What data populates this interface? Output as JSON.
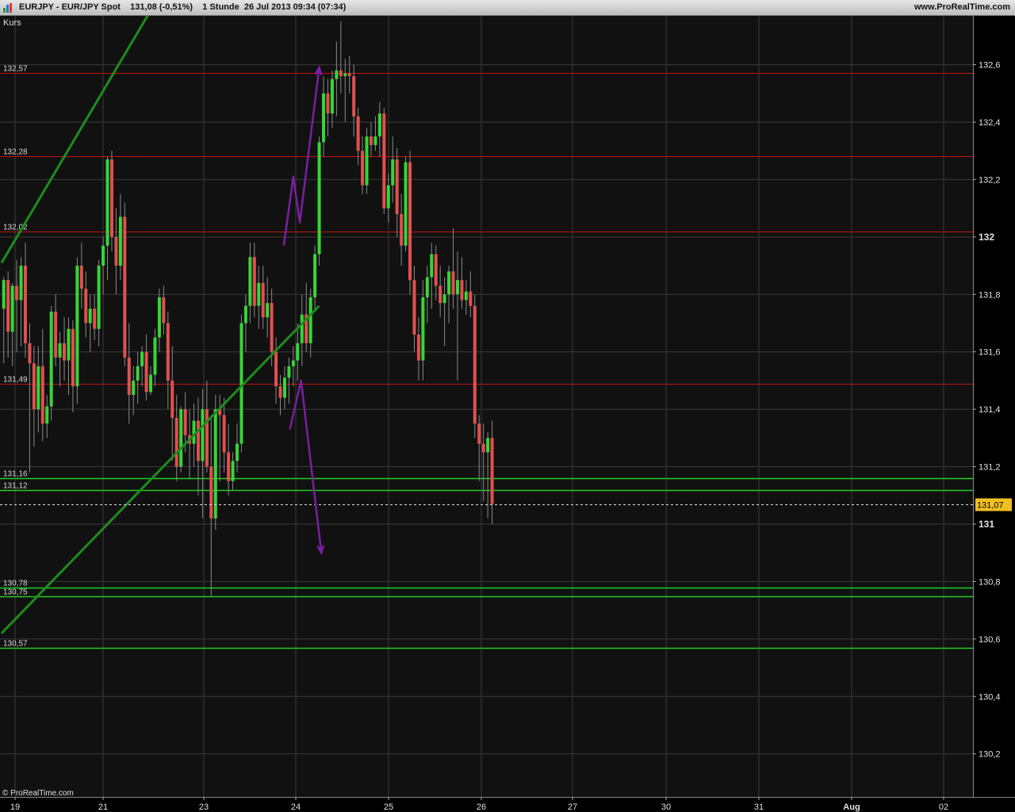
{
  "header": {
    "title": "EURJPY - EUR/JPY Spot    131,08 (-0,51%)    1 Stunde  26 Jul 2013 09:34 (07:34)",
    "website": "www.ProRealTime.com"
  },
  "panel_label": "Kurs",
  "footer": {
    "copyright": "© ProRealTime.com"
  },
  "colors": {
    "background": "#111111",
    "grid": "#3a3a3a",
    "candle_up": "#36d636",
    "candle_down": "#e05050",
    "resistance": "#c41212",
    "support": "#22cc22",
    "channel": "#1e8c1e",
    "projection": "#7b1fa2",
    "current_price_bg": "#f0c020"
  },
  "chart_data": {
    "type": "candlestick",
    "instrument": "EURJPY - EUR/JPY Spot",
    "timeframe": "1 Stunde",
    "y_ticks": [
      "130,2",
      "130,4",
      "130,6",
      "130,8",
      "131",
      "131,2",
      "131,4",
      "131,6",
      "131,8",
      "132",
      "132,2",
      "132,4",
      "132,6"
    ],
    "y_tick_values": [
      130.2,
      130.4,
      130.6,
      130.8,
      131.0,
      131.2,
      131.4,
      131.6,
      131.8,
      132.0,
      132.2,
      132.4,
      132.6
    ],
    "ylim": [
      130.05,
      132.77
    ],
    "x_ticks": [
      "19",
      "21",
      "23",
      "24",
      "25",
      "26",
      "27",
      "30",
      "31",
      "Aug",
      "02"
    ],
    "current_price": "131,07",
    "current_price_value": 131.07,
    "horizontal_levels": [
      {
        "label": "132,57",
        "value": 132.57,
        "kind": "resistance"
      },
      {
        "label": "132,28",
        "value": 132.28,
        "kind": "resistance"
      },
      {
        "label": "132,02",
        "value": 132.02,
        "kind": "resistance"
      },
      {
        "label": "131,49",
        "value": 131.49,
        "kind": "resistance"
      },
      {
        "label": "131,16",
        "value": 131.16,
        "kind": "support"
      },
      {
        "label": "131,12",
        "value": 131.12,
        "kind": "support"
      },
      {
        "label": "130,78",
        "value": 130.78,
        "kind": "support"
      },
      {
        "label": "130,75",
        "value": 130.75,
        "kind": "support"
      },
      {
        "label": "130,57",
        "value": 130.57,
        "kind": "support"
      }
    ],
    "channel_lines": [
      {
        "x": [
          0,
          57.6
        ],
        "y": [
          131.91,
          133.39
        ]
      },
      {
        "x": [
          0,
          73
        ],
        "y": [
          130.62,
          131.76
        ]
      }
    ],
    "projections": [
      {
        "x": [
          64.8,
          67.0,
          68.5,
          73.0
        ],
        "y": [
          131.97,
          132.21,
          132.05,
          132.59
        ],
        "arrow": true
      },
      {
        "x": [
          66.2,
          68.8,
          73.5
        ],
        "y": [
          131.33,
          131.5,
          130.9
        ],
        "arrow": true
      }
    ],
    "candles": [
      {
        "o": 131.75,
        "h": 131.86,
        "l": 131.56,
        "c": 131.85
      },
      {
        "o": 131.85,
        "h": 131.88,
        "l": 131.58,
        "c": 131.67
      },
      {
        "o": 131.67,
        "h": 131.84,
        "l": 131.55,
        "c": 131.83
      },
      {
        "o": 131.83,
        "h": 131.92,
        "l": 131.6,
        "c": 131.78
      },
      {
        "o": 131.78,
        "h": 131.93,
        "l": 131.62,
        "c": 131.9
      },
      {
        "o": 131.9,
        "h": 131.98,
        "l": 131.58,
        "c": 131.63
      },
      {
        "o": 131.63,
        "h": 131.7,
        "l": 131.18,
        "c": 131.56
      },
      {
        "o": 131.56,
        "h": 131.62,
        "l": 131.27,
        "c": 131.4
      },
      {
        "o": 131.4,
        "h": 131.62,
        "l": 131.32,
        "c": 131.55
      },
      {
        "o": 131.55,
        "h": 131.68,
        "l": 131.29,
        "c": 131.35
      },
      {
        "o": 131.35,
        "h": 131.45,
        "l": 131.3,
        "c": 131.41
      },
      {
        "o": 131.41,
        "h": 131.76,
        "l": 131.36,
        "c": 131.74
      },
      {
        "o": 131.74,
        "h": 131.8,
        "l": 131.55,
        "c": 131.58
      },
      {
        "o": 131.58,
        "h": 131.67,
        "l": 131.48,
        "c": 131.63
      },
      {
        "o": 131.63,
        "h": 131.72,
        "l": 131.5,
        "c": 131.57
      },
      {
        "o": 131.57,
        "h": 131.72,
        "l": 131.45,
        "c": 131.68
      },
      {
        "o": 131.68,
        "h": 131.71,
        "l": 131.39,
        "c": 131.48
      },
      {
        "o": 131.48,
        "h": 131.93,
        "l": 131.42,
        "c": 131.9
      },
      {
        "o": 131.9,
        "h": 131.98,
        "l": 131.75,
        "c": 131.82
      },
      {
        "o": 131.82,
        "h": 131.88,
        "l": 131.65,
        "c": 131.7
      },
      {
        "o": 131.7,
        "h": 131.8,
        "l": 131.6,
        "c": 131.75
      },
      {
        "o": 131.75,
        "h": 131.8,
        "l": 131.64,
        "c": 131.68
      },
      {
        "o": 131.68,
        "h": 131.92,
        "l": 131.62,
        "c": 131.9
      },
      {
        "o": 131.9,
        "h": 132.0,
        "l": 131.8,
        "c": 131.97
      },
      {
        "o": 131.97,
        "h": 132.28,
        "l": 131.85,
        "c": 132.27
      },
      {
        "o": 132.27,
        "h": 132.3,
        "l": 131.95,
        "c": 132.0
      },
      {
        "o": 132.0,
        "h": 132.1,
        "l": 131.8,
        "c": 131.9
      },
      {
        "o": 131.9,
        "h": 132.15,
        "l": 131.85,
        "c": 132.07
      },
      {
        "o": 132.07,
        "h": 132.12,
        "l": 131.55,
        "c": 131.58
      },
      {
        "o": 131.58,
        "h": 131.7,
        "l": 131.35,
        "c": 131.45
      },
      {
        "o": 131.45,
        "h": 131.55,
        "l": 131.38,
        "c": 131.5
      },
      {
        "o": 131.5,
        "h": 131.6,
        "l": 131.42,
        "c": 131.55
      },
      {
        "o": 131.55,
        "h": 131.62,
        "l": 131.48,
        "c": 131.6
      },
      {
        "o": 131.6,
        "h": 131.66,
        "l": 131.43,
        "c": 131.46
      },
      {
        "o": 131.46,
        "h": 131.55,
        "l": 131.45,
        "c": 131.52
      },
      {
        "o": 131.52,
        "h": 131.68,
        "l": 131.48,
        "c": 131.65
      },
      {
        "o": 131.65,
        "h": 131.82,
        "l": 131.6,
        "c": 131.79
      },
      {
        "o": 131.79,
        "h": 131.83,
        "l": 131.66,
        "c": 131.7
      },
      {
        "o": 131.7,
        "h": 131.74,
        "l": 131.4,
        "c": 131.5
      },
      {
        "o": 131.5,
        "h": 131.62,
        "l": 131.22,
        "c": 131.37
      },
      {
        "o": 131.37,
        "h": 131.45,
        "l": 131.15,
        "c": 131.2
      },
      {
        "o": 131.2,
        "h": 131.41,
        "l": 131.18,
        "c": 131.4
      },
      {
        "o": 131.4,
        "h": 131.46,
        "l": 131.25,
        "c": 131.31
      },
      {
        "o": 131.31,
        "h": 131.4,
        "l": 131.16,
        "c": 131.28
      },
      {
        "o": 131.28,
        "h": 131.42,
        "l": 131.2,
        "c": 131.36
      },
      {
        "o": 131.36,
        "h": 131.44,
        "l": 131.1,
        "c": 131.22
      },
      {
        "o": 131.22,
        "h": 131.47,
        "l": 131.02,
        "c": 131.4
      },
      {
        "o": 131.4,
        "h": 131.5,
        "l": 131.18,
        "c": 131.2
      },
      {
        "o": 131.2,
        "h": 131.38,
        "l": 130.75,
        "c": 131.02
      },
      {
        "o": 131.02,
        "h": 131.45,
        "l": 130.98,
        "c": 131.4
      },
      {
        "o": 131.4,
        "h": 131.45,
        "l": 131.15,
        "c": 131.38
      },
      {
        "o": 131.38,
        "h": 131.44,
        "l": 131.18,
        "c": 131.25
      },
      {
        "o": 131.25,
        "h": 131.35,
        "l": 131.1,
        "c": 131.15
      },
      {
        "o": 131.15,
        "h": 131.25,
        "l": 131.12,
        "c": 131.22
      },
      {
        "o": 131.22,
        "h": 131.35,
        "l": 131.18,
        "c": 131.28
      },
      {
        "o": 131.28,
        "h": 131.73,
        "l": 131.25,
        "c": 131.7
      },
      {
        "o": 131.7,
        "h": 131.8,
        "l": 131.6,
        "c": 131.76
      },
      {
        "o": 131.76,
        "h": 131.98,
        "l": 131.7,
        "c": 131.93
      },
      {
        "o": 131.93,
        "h": 131.98,
        "l": 131.72,
        "c": 131.76
      },
      {
        "o": 131.76,
        "h": 131.9,
        "l": 131.68,
        "c": 131.84
      },
      {
        "o": 131.84,
        "h": 131.9,
        "l": 131.68,
        "c": 131.72
      },
      {
        "o": 131.72,
        "h": 131.86,
        "l": 131.65,
        "c": 131.77
      },
      {
        "o": 131.77,
        "h": 131.82,
        "l": 131.55,
        "c": 131.6
      },
      {
        "o": 131.6,
        "h": 131.65,
        "l": 131.42,
        "c": 131.48
      },
      {
        "o": 131.48,
        "h": 131.52,
        "l": 131.38,
        "c": 131.44
      },
      {
        "o": 131.44,
        "h": 131.55,
        "l": 131.4,
        "c": 131.51
      },
      {
        "o": 131.51,
        "h": 131.58,
        "l": 131.42,
        "c": 131.55
      },
      {
        "o": 131.55,
        "h": 131.62,
        "l": 131.48,
        "c": 131.57
      },
      {
        "o": 131.57,
        "h": 131.7,
        "l": 131.5,
        "c": 131.63
      },
      {
        "o": 131.63,
        "h": 131.8,
        "l": 131.55,
        "c": 131.73
      },
      {
        "o": 131.73,
        "h": 131.84,
        "l": 131.6,
        "c": 131.63
      },
      {
        "o": 131.63,
        "h": 131.82,
        "l": 131.58,
        "c": 131.79
      },
      {
        "o": 131.79,
        "h": 131.97,
        "l": 131.74,
        "c": 131.94
      },
      {
        "o": 131.94,
        "h": 132.35,
        "l": 131.9,
        "c": 132.33
      },
      {
        "o": 132.33,
        "h": 132.56,
        "l": 132.28,
        "c": 132.5
      },
      {
        "o": 132.5,
        "h": 132.55,
        "l": 132.35,
        "c": 132.43
      },
      {
        "o": 132.43,
        "h": 132.58,
        "l": 132.38,
        "c": 132.55
      },
      {
        "o": 132.55,
        "h": 132.68,
        "l": 132.42,
        "c": 132.58
      },
      {
        "o": 132.58,
        "h": 132.75,
        "l": 132.5,
        "c": 132.56
      },
      {
        "o": 132.56,
        "h": 132.62,
        "l": 132.4,
        "c": 132.57
      },
      {
        "o": 132.57,
        "h": 132.63,
        "l": 132.5,
        "c": 132.56
      },
      {
        "o": 132.56,
        "h": 132.6,
        "l": 132.35,
        "c": 132.42
      },
      {
        "o": 132.42,
        "h": 132.45,
        "l": 132.25,
        "c": 132.3
      },
      {
        "o": 132.3,
        "h": 132.35,
        "l": 132.15,
        "c": 132.18
      },
      {
        "o": 132.18,
        "h": 132.38,
        "l": 132.15,
        "c": 132.35
      },
      {
        "o": 132.35,
        "h": 132.4,
        "l": 132.28,
        "c": 132.32
      },
      {
        "o": 132.32,
        "h": 132.42,
        "l": 132.3,
        "c": 132.35
      },
      {
        "o": 132.35,
        "h": 132.47,
        "l": 132.28,
        "c": 132.43
      },
      {
        "o": 132.43,
        "h": 132.45,
        "l": 132.08,
        "c": 132.1
      },
      {
        "o": 132.1,
        "h": 132.22,
        "l": 132.05,
        "c": 132.18
      },
      {
        "o": 132.18,
        "h": 132.35,
        "l": 132.12,
        "c": 132.27
      },
      {
        "o": 132.27,
        "h": 132.31,
        "l": 132.0,
        "c": 132.08
      },
      {
        "o": 132.08,
        "h": 132.15,
        "l": 131.9,
        "c": 131.97
      },
      {
        "o": 131.97,
        "h": 132.28,
        "l": 131.95,
        "c": 132.26
      },
      {
        "o": 132.26,
        "h": 132.3,
        "l": 131.8,
        "c": 131.85
      },
      {
        "o": 131.85,
        "h": 131.9,
        "l": 131.6,
        "c": 131.66
      },
      {
        "o": 131.66,
        "h": 131.72,
        "l": 131.5,
        "c": 131.57
      },
      {
        "o": 131.57,
        "h": 131.85,
        "l": 131.5,
        "c": 131.79
      },
      {
        "o": 131.79,
        "h": 131.9,
        "l": 131.7,
        "c": 131.86
      },
      {
        "o": 131.86,
        "h": 131.98,
        "l": 131.75,
        "c": 131.94
      },
      {
        "o": 131.94,
        "h": 131.97,
        "l": 131.78,
        "c": 131.83
      },
      {
        "o": 131.83,
        "h": 131.9,
        "l": 131.72,
        "c": 131.77
      },
      {
        "o": 131.77,
        "h": 131.86,
        "l": 131.62,
        "c": 131.8
      },
      {
        "o": 131.8,
        "h": 131.9,
        "l": 131.7,
        "c": 131.88
      },
      {
        "o": 131.88,
        "h": 132.03,
        "l": 131.75,
        "c": 131.8
      },
      {
        "o": 131.8,
        "h": 131.95,
        "l": 131.5,
        "c": 131.85
      },
      {
        "o": 131.85,
        "h": 131.93,
        "l": 131.75,
        "c": 131.78
      },
      {
        "o": 131.78,
        "h": 131.85,
        "l": 131.73,
        "c": 131.81
      },
      {
        "o": 131.81,
        "h": 131.88,
        "l": 131.72,
        "c": 131.76
      },
      {
        "o": 131.76,
        "h": 131.8,
        "l": 131.3,
        "c": 131.35
      },
      {
        "o": 131.35,
        "h": 131.38,
        "l": 131.15,
        "c": 131.28
      },
      {
        "o": 131.28,
        "h": 131.35,
        "l": 131.08,
        "c": 131.25
      },
      {
        "o": 131.25,
        "h": 131.32,
        "l": 131.02,
        "c": 131.3
      },
      {
        "o": 131.3,
        "h": 131.36,
        "l": 131.0,
        "c": 131.07
      }
    ]
  }
}
